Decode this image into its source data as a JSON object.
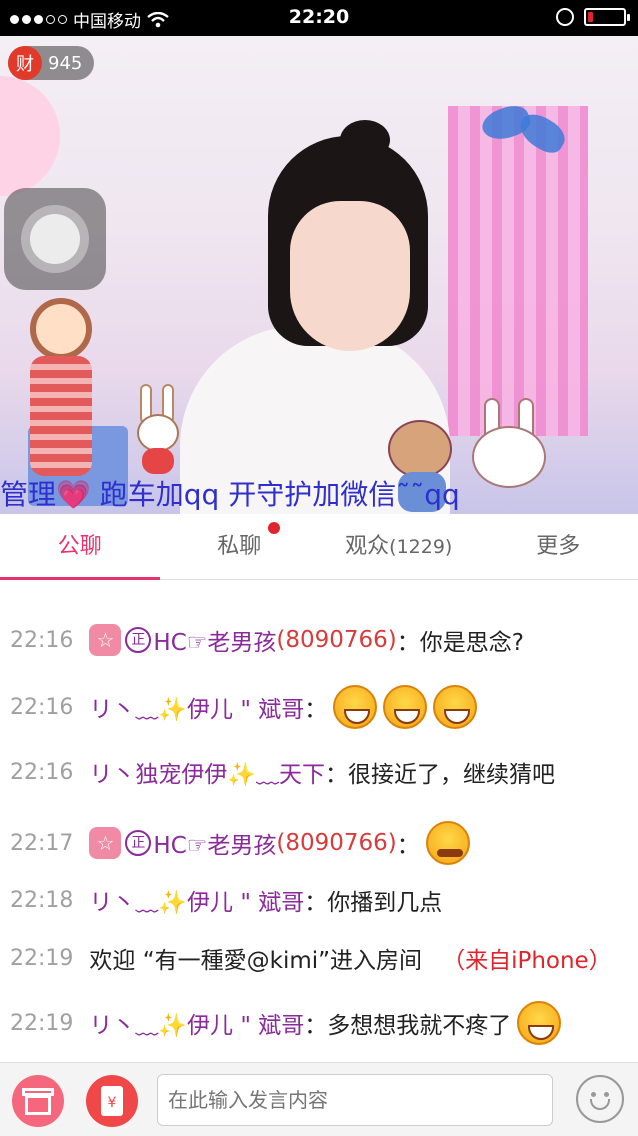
{
  "status_bar": {
    "carrier": "中国移动",
    "time": "22:20",
    "battery_level": 0.15
  },
  "room": {
    "wealth_badge_label": "财",
    "wealth_count": "945",
    "marquee_text": "管理💗 跑车加qq   开守护加微信˜˜qq"
  },
  "tabs": [
    {
      "label": "公聊",
      "active": true
    },
    {
      "label": "私聊",
      "has_dot": true
    },
    {
      "label": "观众",
      "count": "(1229)"
    },
    {
      "label": "更多"
    }
  ],
  "chat": {
    "messages": [
      {
        "time": "22:16",
        "badge": "☆",
        "zheng": "正",
        "user": "HC☞老男孩",
        "uid": "(8090766)",
        "text": "：你是思念?"
      },
      {
        "time": "22:16",
        "user": "リ丶﹏✨伊儿 \" 斌哥",
        "text": "：",
        "emojis": 3
      },
      {
        "time": "22:16",
        "user": "リ丶独宠伊伊✨﹏天下",
        "text": "：很接近了，继续猜吧"
      },
      {
        "time": "22:17",
        "badge": "☆",
        "zheng": "正",
        "user": "HC☞老男孩",
        "uid": "(8090766)",
        "text": "：",
        "emoji_frown": true
      },
      {
        "time": "22:18",
        "user": "リ丶﹏✨伊儿 \" 斌哥",
        "text": "：你播到几点"
      },
      {
        "time": "22:19",
        "system": "欢迎 “有一種愛@kimi”进入房间",
        "from": "（来自iPhone）"
      },
      {
        "time": "22:19",
        "user": "リ丶﹏✨伊儿 \" 斌哥",
        "text": "：多想想我就不疼了",
        "emojis": 1
      }
    ]
  },
  "input": {
    "placeholder": "在此输入发言内容"
  },
  "icons": {
    "gift": "gift-icon",
    "red_packet": "red-packet-icon",
    "red_packet_symbol": "¥",
    "emoji": "smiley-icon"
  },
  "colors": {
    "accent": "#e8336d",
    "username": "#8a2a9b",
    "uid": "#d83b3b",
    "from": "#e0242b"
  }
}
